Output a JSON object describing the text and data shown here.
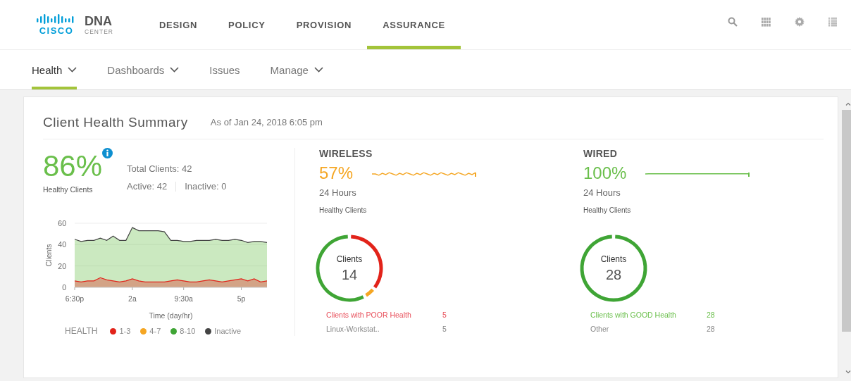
{
  "header": {
    "logo": {
      "brand": "CISCO",
      "product": "DNA",
      "product_sub": "CENTER"
    },
    "nav": [
      {
        "label": "DESIGN",
        "selected": false
      },
      {
        "label": "POLICY",
        "selected": false
      },
      {
        "label": "PROVISION",
        "selected": false
      },
      {
        "label": "ASSURANCE",
        "selected": true
      }
    ]
  },
  "subnav": [
    {
      "label": "Health",
      "selected": true,
      "dropdown": true
    },
    {
      "label": "Dashboards",
      "selected": false,
      "dropdown": true
    },
    {
      "label": "Issues",
      "selected": false,
      "dropdown": false
    },
    {
      "label": "Manage",
      "selected": false,
      "dropdown": true
    }
  ],
  "summary": {
    "title": "Client Health Summary",
    "timestamp": "As of Jan 24, 2018 6:05 pm",
    "overall": {
      "percent": "86%",
      "caption": "Healthy Clients",
      "total": "Total Clients: 42",
      "active": "Active: 42",
      "inactive": "Inactive: 0"
    },
    "chart_data": {
      "type": "area",
      "xlabel": "Time (day/hr)",
      "ylabel": "Clients",
      "categories": [
        "6:30p",
        null,
        null,
        null,
        null,
        null,
        null,
        null,
        null,
        "2a",
        null,
        null,
        null,
        null,
        null,
        null,
        null,
        "9:30a",
        null,
        null,
        null,
        null,
        null,
        null,
        null,
        null,
        "5p",
        null,
        null,
        null,
        null
      ],
      "ylim": [
        0,
        60
      ],
      "yticks": [
        0,
        20,
        40,
        60
      ],
      "series": [
        {
          "color": "#6abf4b",
          "values": [
            45,
            43,
            44,
            44,
            46,
            44,
            48,
            44,
            44,
            56,
            53,
            53,
            53,
            53,
            52,
            44,
            44,
            43,
            43,
            44,
            44,
            44,
            45,
            44,
            44,
            45,
            44,
            42,
            43,
            43,
            42
          ]
        },
        {
          "color": "#e2231a",
          "values": [
            6,
            5,
            6,
            6,
            9,
            7,
            6,
            5,
            6,
            8,
            6,
            5,
            5,
            5,
            5,
            6,
            7,
            6,
            5,
            5,
            6,
            7,
            6,
            5,
            6,
            7,
            8,
            6,
            8,
            5,
            6
          ]
        }
      ]
    },
    "legend": {
      "title": "HEALTH",
      "items": [
        {
          "label": "1-3",
          "color": "#e2231a"
        },
        {
          "label": "4-7",
          "color": "#f5a623"
        },
        {
          "label": "8-10",
          "color": "#3fa535"
        },
        {
          "label": "Inactive",
          "color": "#444444"
        }
      ]
    }
  },
  "sections": [
    {
      "title": "WIRELESS",
      "color": "#f5a623",
      "percent": "57%",
      "period": "24 Hours",
      "caption": "Healthy Clients",
      "donut": {
        "label": "Clients",
        "count": "14",
        "segments": [
          {
            "color": "#e2231a"
          },
          {
            "color": "#f5a623"
          },
          {
            "color": "#3fa535"
          }
        ]
      },
      "breakdown": [
        {
          "label": "Clients with POOR Health",
          "value": "5",
          "kind": "poor"
        },
        {
          "label": "Linux-Workstat..",
          "value": "5",
          "kind": "other"
        }
      ]
    },
    {
      "title": "WIRED",
      "color": "#6abf4b",
      "percent": "100%",
      "period": "24 Hours",
      "caption": "Healthy Clients",
      "donut": {
        "label": "Clients",
        "count": "28",
        "segments": [
          {
            "color": "#3fa535"
          }
        ]
      },
      "breakdown": [
        {
          "label": "Clients with GOOD Health",
          "value": "28",
          "kind": "good"
        },
        {
          "label": "Other",
          "value": "28",
          "kind": "other"
        }
      ]
    }
  ]
}
